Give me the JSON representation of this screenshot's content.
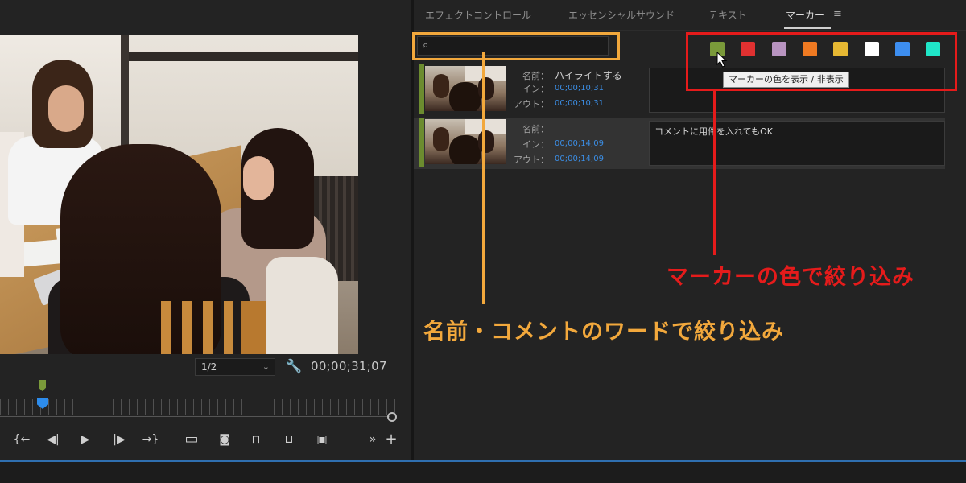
{
  "program_monitor": {
    "fit_select": {
      "value": "1/2",
      "chevron": "chevron-down-icon"
    },
    "wrench": "wrench-icon",
    "timecode": "00;00;31;07",
    "transport": [
      {
        "id": "mark-in",
        "glyph": "{←"
      },
      {
        "id": "step-back",
        "glyph": "◀|"
      },
      {
        "id": "play",
        "glyph": "▶"
      },
      {
        "id": "step-forward",
        "glyph": "|▶"
      },
      {
        "id": "go-to-out",
        "glyph": "→}"
      },
      {
        "id": "safe-margins",
        "glyph": "▭"
      },
      {
        "id": "export-frame",
        "glyph": "◙"
      },
      {
        "id": "lift",
        "glyph": "⊓"
      },
      {
        "id": "extract",
        "glyph": "⊔"
      },
      {
        "id": "compare",
        "glyph": "▣"
      },
      {
        "id": "more",
        "glyph": "»"
      },
      {
        "id": "add",
        "glyph": "+"
      }
    ]
  },
  "tabs": [
    {
      "label": "エフェクトコントロール"
    },
    {
      "label": "エッセンシャルサウンド"
    },
    {
      "label": "テキスト"
    },
    {
      "label": "マーカー"
    }
  ],
  "menu_icon": "≡",
  "search": {
    "placeholder": "",
    "value": ""
  },
  "swatches": [
    {
      "color": "#7a9a3a"
    },
    {
      "color": "#e03131"
    },
    {
      "color": "#b894c0"
    },
    {
      "color": "#ef7a22"
    },
    {
      "color": "#e6b833"
    },
    {
      "color": "#ffffff"
    },
    {
      "color": "#3d8ef0"
    },
    {
      "color": "#20e6c8"
    }
  ],
  "tooltip": "マーカーの色を表示 / 非表示",
  "markers": [
    {
      "name_label": "名前：",
      "name": "ハイライトする",
      "in_label": "イン：",
      "in": "00;00;10;31",
      "out_label": "アウト：",
      "out": "00;00;10;31",
      "comment": ""
    },
    {
      "name_label": "名前：",
      "name": "",
      "in_label": "イン：",
      "in": "00;00;14;09",
      "out_label": "アウト：",
      "out": "00;00;14;09",
      "comment": "コメントに用件を入れてもOK"
    }
  ],
  "annotations": {
    "search_note": "名前・コメントのワードで絞り込み",
    "color_note": "マーカーの色で絞り込み",
    "search_color": "#f2a83c",
    "color_color": "#e51b1b"
  }
}
